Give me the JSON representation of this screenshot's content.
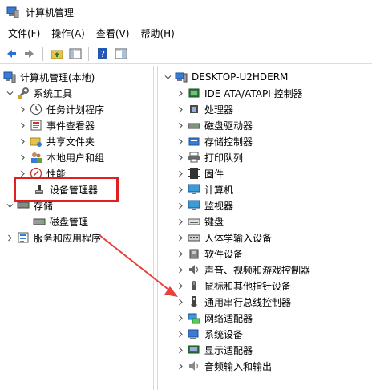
{
  "window": {
    "title": "计算机管理"
  },
  "menu": {
    "file": "文件(F)",
    "action": "操作(A)",
    "view": "查看(V)",
    "help": "帮助(H)"
  },
  "left_tree": {
    "root": "计算机管理(本地)",
    "system_tools": "系统工具",
    "task_scheduler": "任务计划程序",
    "event_viewer": "事件查看器",
    "shared_folders": "共享文件夹",
    "local_users": "本地用户和组",
    "performance": "性能",
    "device_manager": "设备管理器",
    "storage": "存储",
    "disk_management": "磁盘管理",
    "services_apps": "服务和应用程序"
  },
  "right_tree": {
    "computer_name": "DESKTOP-U2HDERM",
    "categories": [
      "IDE ATA/ATAPI 控制器",
      "处理器",
      "磁盘驱动器",
      "存储控制器",
      "打印队列",
      "固件",
      "计算机",
      "监视器",
      "键盘",
      "人体学输入设备",
      "软件设备",
      "声音、视频和游戏控制器",
      "鼠标和其他指针设备",
      "通用串行总线控制器",
      "网络适配器",
      "系统设备",
      "显示适配器",
      "音频输入和输出"
    ]
  },
  "colors": {
    "highlight": "#e02020",
    "arrow": "#e8403a",
    "chevron": "#555555"
  }
}
